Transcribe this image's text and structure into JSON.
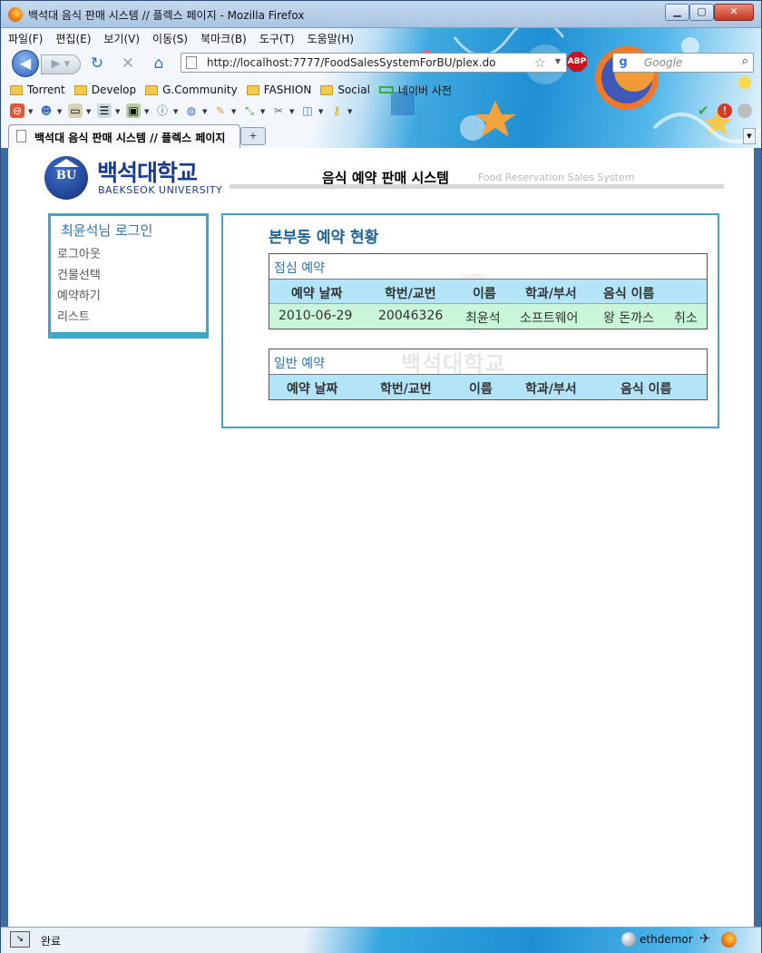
{
  "window": {
    "title": "백석대 음식 판매 시스템 // 플렉스 페이지 - Mozilla Firefox",
    "min_label": "▁",
    "max_label": "▢",
    "close_label": "✕"
  },
  "menu": [
    "파일(F)",
    "편집(E)",
    "보기(V)",
    "이동(S)",
    "북마크(B)",
    "도구(T)",
    "도움말(H)"
  ],
  "nav": {
    "url": "http://localhost:7777/FoodSalesSystemForBU/plex.do",
    "search_placeholder": "Google",
    "abp_label": "ABP"
  },
  "bookmarks": [
    {
      "label": "Torrent",
      "icon": "folder-icon"
    },
    {
      "label": "Develop",
      "icon": "folder-icon"
    },
    {
      "label": "G.Community",
      "icon": "folder-icon"
    },
    {
      "label": "FASHION",
      "icon": "folder-icon"
    },
    {
      "label": "Social",
      "icon": "folder-icon"
    },
    {
      "label": "네이버 사전",
      "icon": "naver-icon"
    }
  ],
  "tab": {
    "label": "백석대 음식 판매 시스템 // 플렉스 페이지",
    "new_tab_label": "+"
  },
  "page": {
    "logo": {
      "korean": "백석대학교",
      "english": "BAEKSEOK UNIVERSITY",
      "mark": "BU"
    },
    "system_title": "음식 예약 판매 시스템",
    "system_subtitle": "Food Reservation Sales System",
    "sidebar": {
      "title": "최윤석님 로그인",
      "links": [
        "로그아웃",
        "건물선택",
        "예약하기",
        "리스트"
      ]
    },
    "main": {
      "title": "본부동 예약 현황",
      "watermark": "백석대학교",
      "lunch": {
        "caption": "점심 예약",
        "headers": [
          "예약 날짜",
          "학번/교번",
          "이름",
          "학과/부서",
          "음식 이름"
        ],
        "rows": [
          {
            "date": "2010-06-29",
            "id": "20046326",
            "name": "최윤석",
            "dept": "소프트웨어",
            "food": "왕 돈까스",
            "action": "취소"
          }
        ]
      },
      "general": {
        "caption": "일반 예약",
        "headers": [
          "예약 날짜",
          "학번/교번",
          "이름",
          "학과/부서",
          "음식 이름"
        ]
      }
    }
  },
  "status": {
    "text": "완료",
    "user": "ethdemor"
  }
}
